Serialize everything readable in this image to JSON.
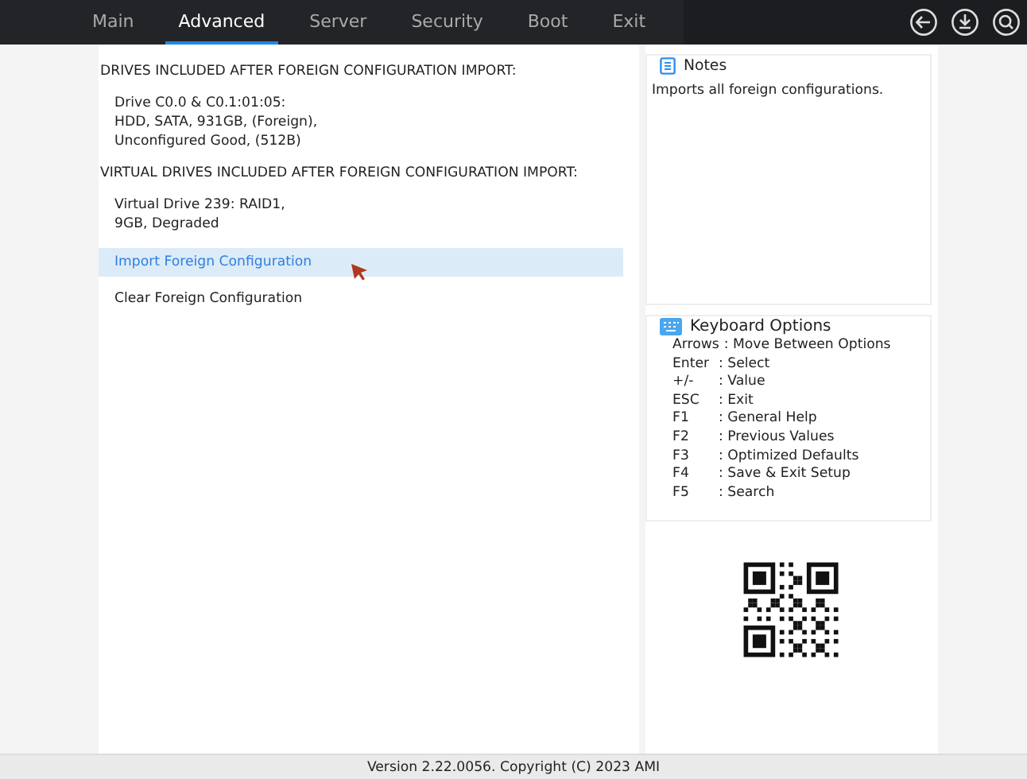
{
  "tabs": [
    {
      "label": "Main",
      "selected": false
    },
    {
      "label": "Advanced",
      "selected": true
    },
    {
      "label": "Server",
      "selected": false
    },
    {
      "label": "Security",
      "selected": false
    },
    {
      "label": "Boot",
      "selected": false
    },
    {
      "label": "Exit",
      "selected": false
    }
  ],
  "form": {
    "items": [
      {
        "kind": "header",
        "text": "DRIVES INCLUDED AFTER FOREIGN CONFIGURATION IMPORT:"
      },
      {
        "kind": "info",
        "text": "Drive C0.0 & C0.1:01:05: HDD, SATA, 931GB, (Foreign), Unconfigured Good, (512B)"
      },
      {
        "kind": "header",
        "text": "VIRTUAL DRIVES INCLUDED AFTER FOREIGN CONFIGURATION IMPORT:"
      },
      {
        "kind": "info",
        "text": "Virtual Drive 239: RAID1, 9GB, Degraded"
      },
      {
        "kind": "action",
        "text": "Import Foreign Configuration",
        "selected": true
      },
      {
        "kind": "action",
        "text": "Clear Foreign Configuration",
        "selected": false
      }
    ]
  },
  "notes": {
    "title": "Notes",
    "text": "Imports all foreign configurations."
  },
  "keyboard_options": {
    "title": "Keyboard Options",
    "items": [
      {
        "key": "Arrows",
        "action": ": Move Between Options"
      },
      {
        "key": "Enter",
        "action": ": Select"
      },
      {
        "key": "+/-",
        "action": ": Value"
      },
      {
        "key": "ESC",
        "action": ": Exit"
      },
      {
        "key": "F1",
        "action": ": General Help"
      },
      {
        "key": "F2",
        "action": ": Previous Values"
      },
      {
        "key": "F3",
        "action": ": Optimized Defaults"
      },
      {
        "key": "F4",
        "action": ": Save & Exit Setup"
      },
      {
        "key": "F5",
        "action": ": Search"
      }
    ]
  },
  "footer": "Version 2.22.0056. Copyright (C) 2023 AMI"
}
